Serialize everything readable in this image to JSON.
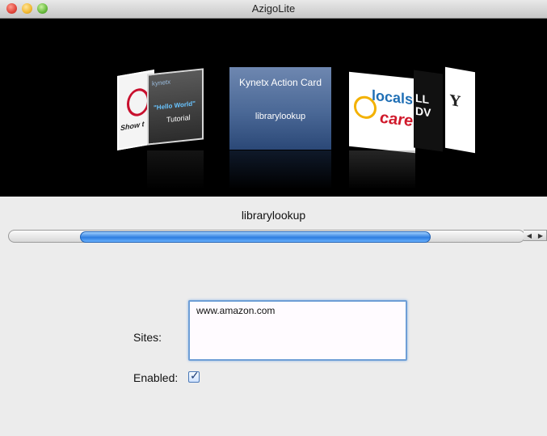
{
  "window": {
    "title": "AzigoLite"
  },
  "coverflow": {
    "cards": [
      {
        "id": "show",
        "text": "Show t"
      },
      {
        "id": "hello",
        "line1": "kynetx",
        "line2": "\"Hello World\"",
        "line3": "Tutorial"
      },
      {
        "id": "center",
        "title": "Kynetx Action Card",
        "subtitle": "librarylookup"
      },
      {
        "id": "locals",
        "line1": "locals",
        "line2": "care"
      },
      {
        "id": "cnn",
        "text": "LL DV"
      },
      {
        "id": "yahoo",
        "text": "Y"
      }
    ]
  },
  "selected_label": "librarylookup",
  "form": {
    "sites_label": "Sites:",
    "sites_value": "www.amazon.com",
    "enabled_label": "Enabled:",
    "enabled": true,
    "check_glyph": "✓"
  },
  "scroller": {
    "left_arrow": "◀",
    "right_arrow": "▶"
  }
}
